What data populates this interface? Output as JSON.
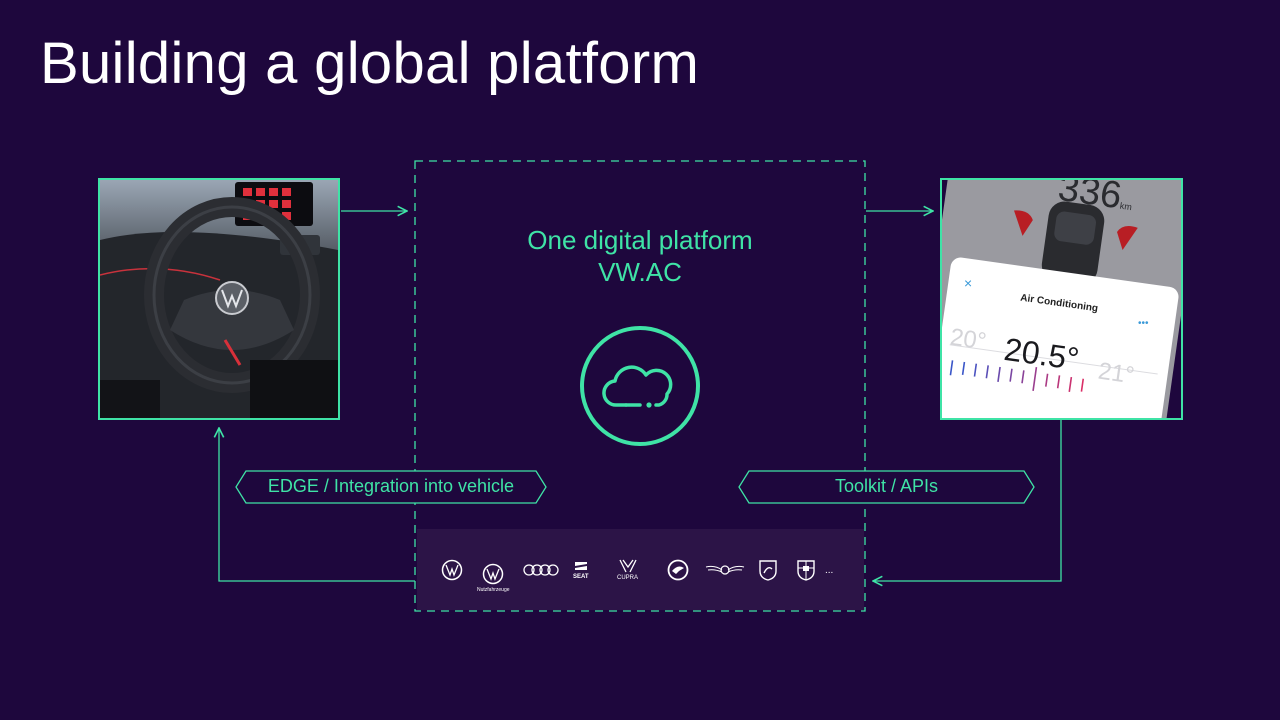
{
  "page": {
    "title": "Building a global platform"
  },
  "platform": {
    "line1": "One digital platform",
    "line2": "VW.AC"
  },
  "tags": {
    "edge": "EDGE / Integration into vehicle",
    "toolkit": "Toolkit / APIs"
  },
  "app": {
    "range_value": "336",
    "range_unit": "km",
    "panel_title": "Air Conditioning",
    "temp_left": "20°",
    "temp_current": "20.5°",
    "temp_right": "21°"
  },
  "brands": {
    "items": [
      "vw-logo",
      "vw-nutzfahrzeuge-logo",
      "audi-logo",
      "seat-logo",
      "cupra-logo",
      "skoda-logo",
      "bentley-logo",
      "lamborghini-logo",
      "porsche-logo"
    ],
    "nutzfahrzeuge_label": "Nutzfahrzeuge",
    "seat_label": "SEAT",
    "cupra_label": "CUPRA",
    "more": "..."
  },
  "colors": {
    "background": "#1e073d",
    "accent": "#3fe3a6",
    "strip": "#2c1447"
  }
}
